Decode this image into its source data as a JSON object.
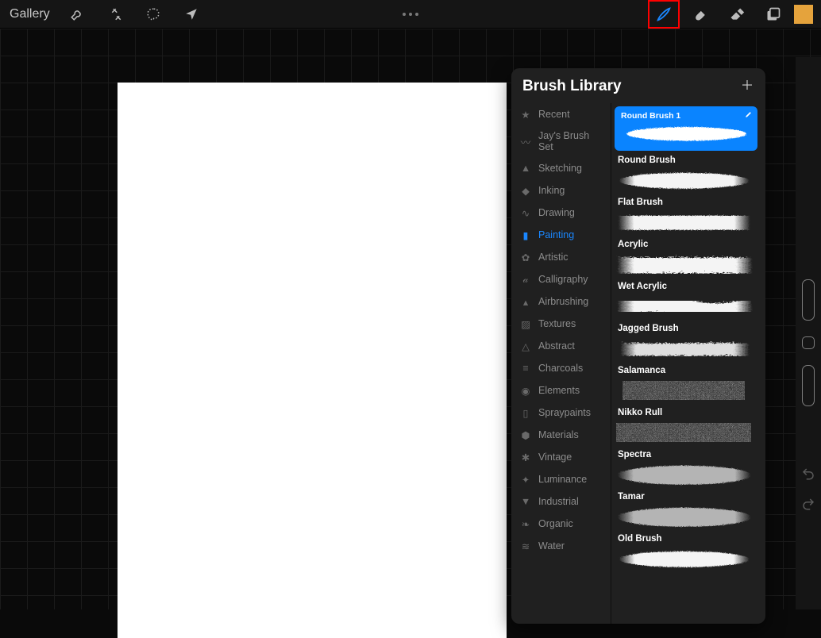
{
  "topbar": {
    "gallery_label": "Gallery",
    "brush_tool_active": true
  },
  "panel": {
    "title": "Brush Library",
    "categories": [
      {
        "label": "Recent"
      },
      {
        "label": "Jay's Brush Set"
      },
      {
        "label": "Sketching"
      },
      {
        "label": "Inking"
      },
      {
        "label": "Drawing"
      },
      {
        "label": "Painting"
      },
      {
        "label": "Artistic"
      },
      {
        "label": "Calligraphy"
      },
      {
        "label": "Airbrushing"
      },
      {
        "label": "Textures"
      },
      {
        "label": "Abstract"
      },
      {
        "label": "Charcoals"
      },
      {
        "label": "Elements"
      },
      {
        "label": "Spraypaints"
      },
      {
        "label": "Materials"
      },
      {
        "label": "Vintage"
      },
      {
        "label": "Luminance"
      },
      {
        "label": "Industrial"
      },
      {
        "label": "Organic"
      },
      {
        "label": "Water"
      }
    ],
    "active_category_index": 5,
    "selected_brush": "Round Brush 1",
    "brushes": [
      {
        "name": "Round Brush"
      },
      {
        "name": "Flat Brush"
      },
      {
        "name": "Acrylic"
      },
      {
        "name": "Wet Acrylic"
      },
      {
        "name": "Jagged Brush"
      },
      {
        "name": "Salamanca"
      },
      {
        "name": "Nikko Rull"
      },
      {
        "name": "Spectra"
      },
      {
        "name": "Tamar"
      },
      {
        "name": "Old Brush"
      }
    ]
  },
  "color_swatch": "#e5a33c"
}
